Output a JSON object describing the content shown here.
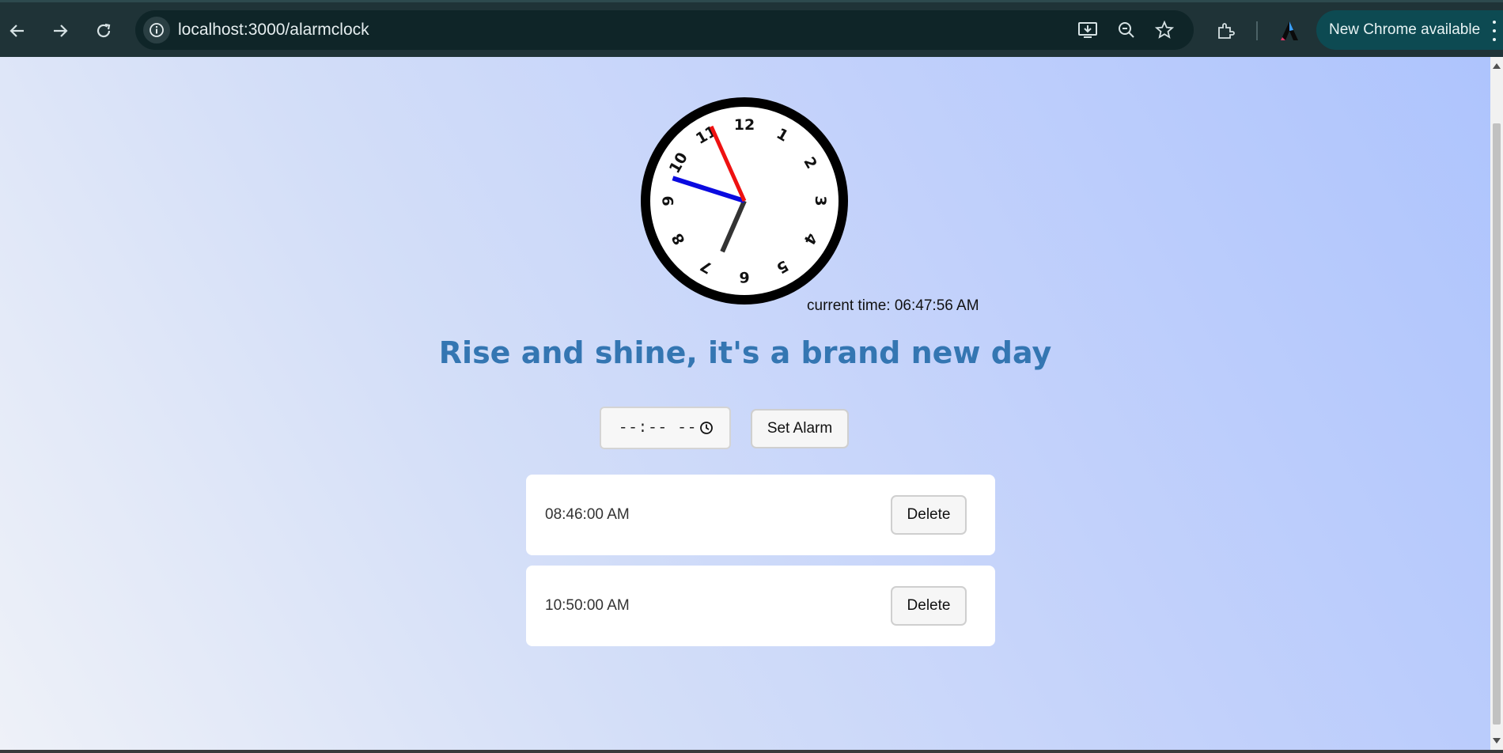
{
  "browser": {
    "url": "localhost:3000/alarmclock",
    "update_label": "New Chrome available"
  },
  "clock": {
    "numerals": [
      "12",
      "1",
      "2",
      "3",
      "4",
      "5",
      "6",
      "7",
      "8",
      "9",
      "10",
      "11"
    ],
    "hands": {
      "hour_time": "06:47:56",
      "hour_color": "#333333",
      "minute_color": "#0a0ae0",
      "second_color": "#ee1111"
    }
  },
  "current_time": "current time: 06:47:56 AM",
  "headline": "Rise and shine, it's a brand new day",
  "time_input": {
    "display": "--:-- --"
  },
  "set_alarm_label": "Set Alarm",
  "alarms": [
    {
      "time": "08:46:00 AM",
      "delete_label": "Delete"
    },
    {
      "time": "10:50:00 AM",
      "delete_label": "Delete"
    }
  ],
  "colors": {
    "headline": "#3476b2",
    "chrome_bar": "#1f3337",
    "update_pill": "#0d4a52"
  }
}
